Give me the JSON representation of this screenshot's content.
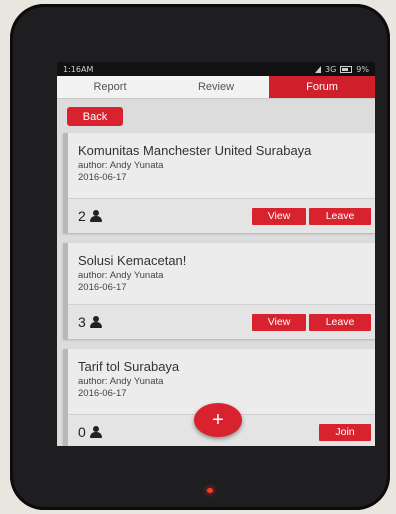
{
  "status_bar": {
    "time": "1:16AM",
    "network": "3G",
    "battery": "9%"
  },
  "tabs": [
    {
      "label": "Report",
      "active": false
    },
    {
      "label": "Review",
      "active": false
    },
    {
      "label": "Forum",
      "active": true
    }
  ],
  "back_label": "Back",
  "forums": [
    {
      "title": "Komunitas Manchester United Surabaya",
      "author": "author: Andy Yunata",
      "date": "2016-06-17",
      "members": "2",
      "view_label": "View",
      "leave_label": "Leave"
    },
    {
      "title": "Solusi Kemacetan!",
      "author": "author: Andy Yunata",
      "date": "2016-06-17",
      "members": "3",
      "view_label": "View",
      "leave_label": "Leave"
    },
    {
      "title": "Tarif tol Surabaya",
      "author": "author: Andy Yunata",
      "date": "2016-06-17",
      "members": "0",
      "join_label": "Join"
    }
  ],
  "fab_label": "+",
  "colors": {
    "accent": "#d8232f",
    "background": "#dcdcdc"
  }
}
